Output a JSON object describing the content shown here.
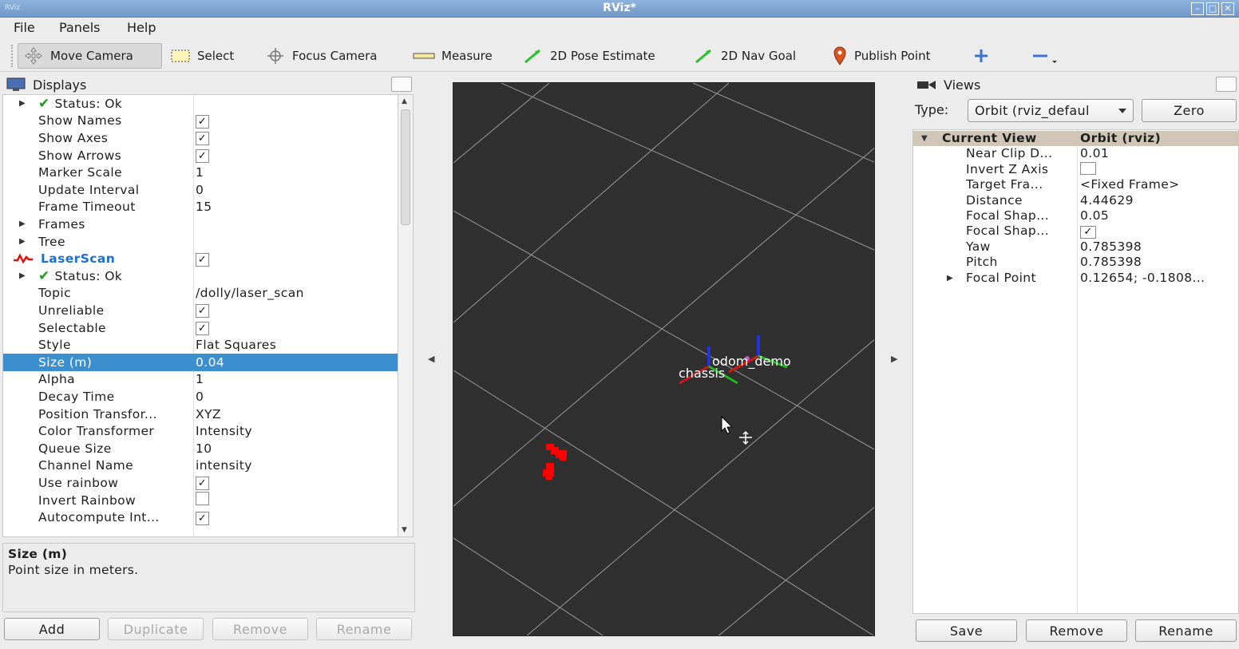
{
  "window": {
    "title": "RViz*",
    "app_icon_text": "RViz"
  },
  "menu": [
    "File",
    "Panels",
    "Help"
  ],
  "toolbar": {
    "tools": [
      {
        "label": "Move Camera",
        "icon": "move-camera-icon",
        "active": true
      },
      {
        "label": "Select",
        "icon": "select-icon"
      },
      {
        "label": "Focus Camera",
        "icon": "focus-camera-icon"
      },
      {
        "label": "Measure",
        "icon": "measure-icon"
      },
      {
        "label": "2D Pose Estimate",
        "icon": "pose-estimate-icon"
      },
      {
        "label": "2D Nav Goal",
        "icon": "nav-goal-icon"
      },
      {
        "label": "Publish Point",
        "icon": "publish-point-icon"
      }
    ]
  },
  "displays": {
    "title": "Displays",
    "rows": [
      {
        "name": "Status: Ok",
        "value": "",
        "expander": true,
        "check_icon": true
      },
      {
        "name": "Show Names",
        "checkbox": true
      },
      {
        "name": "Show Axes",
        "checkbox": true
      },
      {
        "name": "Show Arrows",
        "checkbox": true
      },
      {
        "name": "Marker Scale",
        "value": "1"
      },
      {
        "name": "Update Interval",
        "value": "0"
      },
      {
        "name": "Frame Timeout",
        "value": "15"
      },
      {
        "name": "Frames",
        "value": "",
        "expander": true
      },
      {
        "name": "Tree",
        "value": "",
        "expander": true
      },
      {
        "name": "LaserScan",
        "checkbox": true,
        "laser": true
      },
      {
        "name": "Status: Ok",
        "value": "",
        "expander": true,
        "check_icon": true
      },
      {
        "name": "Topic",
        "value": "/dolly/laser_scan"
      },
      {
        "name": "Unreliable",
        "checkbox": true
      },
      {
        "name": "Selectable",
        "checkbox": true
      },
      {
        "name": "Style",
        "value": "Flat Squares"
      },
      {
        "name": "Size (m)",
        "value": "0.04",
        "selected": true
      },
      {
        "name": "Alpha",
        "value": "1"
      },
      {
        "name": "Decay Time",
        "value": "0"
      },
      {
        "name": "Position Transfor...",
        "value": "XYZ"
      },
      {
        "name": "Color Transformer",
        "value": "Intensity"
      },
      {
        "name": "Queue Size",
        "value": "10"
      },
      {
        "name": "Channel Name",
        "value": "intensity"
      },
      {
        "name": "Use rainbow",
        "checkbox": true
      },
      {
        "name": "Invert Rainbow",
        "checkbox": false
      },
      {
        "name": "Autocompute Int...",
        "checkbox": true
      }
    ],
    "help_title": "Size (m)",
    "help_desc": "Point size in meters.",
    "buttons": {
      "add": "Add",
      "duplicate": "Duplicate",
      "remove": "Remove",
      "rename": "Rename"
    }
  },
  "viewport": {
    "labels": {
      "odom": "odom_demo",
      "chassis": "chassis"
    }
  },
  "views": {
    "title": "Views",
    "type_label": "Type:",
    "type_value": "Orbit (rviz_defaul",
    "zero_label": "Zero",
    "header": {
      "name": "Current View",
      "value": "Orbit (rviz)"
    },
    "rows": [
      {
        "name": "Near Clip D...",
        "value": "0.01"
      },
      {
        "name": "Invert Z Axis",
        "checkbox": false
      },
      {
        "name": "Target Fra...",
        "value": "<Fixed Frame>"
      },
      {
        "name": "Distance",
        "value": "4.44629"
      },
      {
        "name": "Focal Shap...",
        "value": "0.05"
      },
      {
        "name": "Focal Shap...",
        "checkbox": true
      },
      {
        "name": "Yaw",
        "value": "0.785398"
      },
      {
        "name": "Pitch",
        "value": "0.785398"
      },
      {
        "name": "Focal Point",
        "value": "0.12654; -0.1808...",
        "expander": true
      }
    ],
    "buttons": {
      "save": "Save",
      "remove": "Remove",
      "rename": "Rename"
    }
  }
}
